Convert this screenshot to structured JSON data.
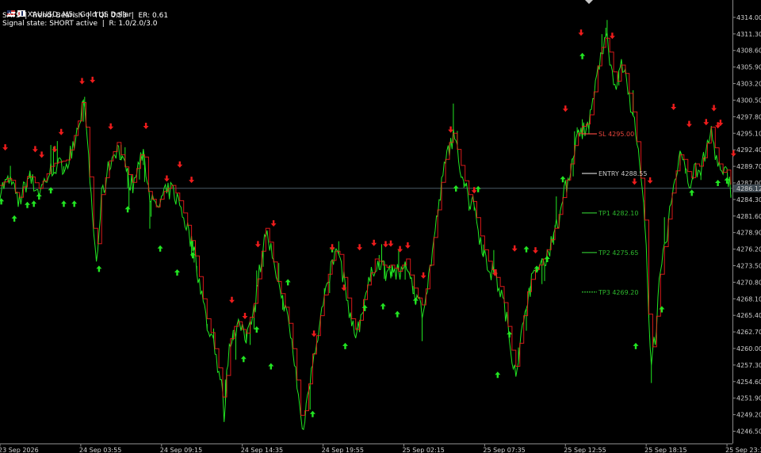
{
  "window": {
    "symbol_title": "XAUUSD, M5:  Gold US Dollar",
    "status_line": "SATS  |  Trend: Bearish  |  TQI: 0.53  |  ER: 0.61",
    "signal_line": "Signal state: SHORT active  |  R: 1.0/2.0/3.0"
  },
  "colors": {
    "background": "#000000",
    "bull": "#22e622",
    "bear": "#ee1c1c",
    "axis_text": "#d0d0d0",
    "sl": "#e8453c",
    "entry": "#c8c8c8",
    "tp": "#2db82d",
    "current_line": "#4a5a66"
  },
  "icons": {
    "up_arrow": "arrow-up-icon",
    "down_arrow": "arrow-down-icon",
    "flag": "flag-icon",
    "candles": "candles-icon"
  },
  "chart_data": {
    "type": "line",
    "title": "XAUUSD, M5:  Gold US Dollar",
    "ylim": [
      4244.5,
      4315.8
    ],
    "y_ticks": [
      "4314.00",
      "4311.30",
      "4308.60",
      "4305.90",
      "4303.20",
      "4300.50",
      "4297.80",
      "4295.10",
      "4292.40",
      "4289.70",
      "4287.00",
      "4284.30",
      "4281.60",
      "4278.90",
      "4276.20",
      "4273.50",
      "4270.80",
      "4268.10",
      "4265.40",
      "4262.70",
      "4260.00",
      "4257.30",
      "4254.60",
      "4251.90",
      "4249.20",
      "4246.50"
    ],
    "y_tick_values": [
      4314.0,
      4311.3,
      4308.6,
      4305.9,
      4303.2,
      4300.5,
      4297.8,
      4295.1,
      4292.4,
      4289.7,
      4287.0,
      4284.3,
      4281.6,
      4278.9,
      4276.2,
      4273.5,
      4270.8,
      4268.1,
      4265.4,
      4262.7,
      4260.0,
      4257.3,
      4254.6,
      4251.9,
      4249.2,
      4246.5
    ],
    "x_ticks": [
      "23 Sep 2026",
      "24 Sep 03:55",
      "24 Sep 09:15",
      "24 Sep 14:35",
      "24 Sep 19:55",
      "25 Sep 02:15",
      "25 Sep 07:35",
      "25 Sep 12:55",
      "25 Sep 18:15",
      "25 Sep 23:35"
    ],
    "x_tick_index": [
      0,
      62,
      124,
      186,
      248,
      310,
      372,
      434,
      496,
      558
    ],
    "bar_count": 562,
    "current_price": "4286.12",
    "current_price_value": 4286.12,
    "levels": [
      {
        "label": "SL  4295.00",
        "value": 4295.0,
        "kind": "sl"
      },
      {
        "label": "ENTRY  4288.55",
        "value": 4288.55,
        "kind": "entry"
      },
      {
        "label": "TP1  4282.10",
        "value": 4282.1,
        "kind": "tp"
      },
      {
        "label": "TP2  4275.65",
        "value": 4275.65,
        "kind": "tp"
      },
      {
        "label": "TP3  4269.20",
        "value": 4269.2,
        "kind": "tp"
      }
    ],
    "price_path": [
      [
        0,
        4286.0
      ],
      [
        8,
        4287.5
      ],
      [
        14,
        4283.5
      ],
      [
        22,
        4288.0
      ],
      [
        30,
        4285.5
      ],
      [
        40,
        4289.5
      ],
      [
        52,
        4290.2
      ],
      [
        60,
        4296.5
      ],
      [
        64,
        4300.5
      ],
      [
        67,
        4293.0
      ],
      [
        72,
        4279.0
      ],
      [
        74,
        4273.8
      ],
      [
        78,
        4284.5
      ],
      [
        84,
        4290.0
      ],
      [
        90,
        4293.0
      ],
      [
        96,
        4289.0
      ],
      [
        102,
        4286.5
      ],
      [
        110,
        4292.5
      ],
      [
        114,
        4285.0
      ],
      [
        120,
        4282.5
      ],
      [
        126,
        4285.0
      ],
      [
        132,
        4286.0
      ],
      [
        138,
        4283.5
      ],
      [
        144,
        4279.5
      ],
      [
        150,
        4274.5
      ],
      [
        154,
        4270.0
      ],
      [
        158,
        4265.0
      ],
      [
        162,
        4262.0
      ],
      [
        166,
        4258.5
      ],
      [
        170,
        4254.0
      ],
      [
        172,
        4249.0
      ],
      [
        175,
        4258.0
      ],
      [
        178,
        4262.5
      ],
      [
        184,
        4264.0
      ],
      [
        188,
        4261.0
      ],
      [
        192,
        4264.5
      ],
      [
        196,
        4267.5
      ],
      [
        200,
        4274.0
      ],
      [
        204,
        4279.0
      ],
      [
        208,
        4276.0
      ],
      [
        212,
        4271.0
      ],
      [
        218,
        4267.0
      ],
      [
        222,
        4263.5
      ],
      [
        226,
        4258.0
      ],
      [
        230,
        4250.5
      ],
      [
        232,
        4246.5
      ],
      [
        236,
        4252.0
      ],
      [
        240,
        4258.5
      ],
      [
        244,
        4262.5
      ],
      [
        248,
        4267.0
      ],
      [
        252,
        4271.5
      ],
      [
        256,
        4274.5
      ],
      [
        260,
        4276.0
      ],
      [
        264,
        4271.0
      ],
      [
        268,
        4266.5
      ],
      [
        272,
        4262.0
      ],
      [
        276,
        4264.0
      ],
      [
        280,
        4268.5
      ],
      [
        284,
        4271.0
      ],
      [
        288,
        4274.0
      ],
      [
        292,
        4273.5
      ],
      [
        296,
        4272.5
      ],
      [
        300,
        4273.0
      ],
      [
        306,
        4272.0
      ],
      [
        312,
        4274.0
      ],
      [
        316,
        4270.5
      ],
      [
        320,
        4268.0
      ],
      [
        324,
        4266.5
      ],
      [
        328,
        4270.0
      ],
      [
        332,
        4276.0
      ],
      [
        336,
        4282.0
      ],
      [
        340,
        4288.0
      ],
      [
        344,
        4292.5
      ],
      [
        348,
        4294.5
      ],
      [
        352,
        4291.0
      ],
      [
        356,
        4287.5
      ],
      [
        360,
        4284.5
      ],
      [
        364,
        4283.0
      ],
      [
        368,
        4278.5
      ],
      [
        372,
        4275.5
      ],
      [
        376,
        4273.0
      ],
      [
        380,
        4271.5
      ],
      [
        384,
        4269.5
      ],
      [
        388,
        4266.0
      ],
      [
        392,
        4260.0
      ],
      [
        396,
        4256.5
      ],
      [
        400,
        4261.5
      ],
      [
        404,
        4268.0
      ],
      [
        410,
        4272.0
      ],
      [
        416,
        4273.5
      ],
      [
        422,
        4276.5
      ],
      [
        426,
        4279.0
      ],
      [
        430,
        4282.0
      ],
      [
        434,
        4286.0
      ],
      [
        438,
        4289.5
      ],
      [
        442,
        4293.5
      ],
      [
        446,
        4295.5
      ],
      [
        450,
        4296.0
      ],
      [
        454,
        4298.0
      ],
      [
        458,
        4304.5
      ],
      [
        462,
        4308.5
      ],
      [
        466,
        4310.5
      ],
      [
        470,
        4305.0
      ],
      [
        474,
        4303.0
      ],
      [
        478,
        4306.5
      ],
      [
        482,
        4302.0
      ],
      [
        486,
        4298.0
      ],
      [
        490,
        4291.5
      ],
      [
        493,
        4285.0
      ],
      [
        496,
        4278.0
      ],
      [
        498,
        4265.0
      ],
      [
        500,
        4258.5
      ],
      [
        503,
        4262.0
      ],
      [
        506,
        4270.0
      ],
      [
        510,
        4276.0
      ],
      [
        514,
        4282.0
      ],
      [
        518,
        4287.5
      ],
      [
        522,
        4291.0
      ],
      [
        526,
        4290.0
      ],
      [
        530,
        4286.5
      ],
      [
        534,
        4289.5
      ],
      [
        538,
        4289.0
      ],
      [
        542,
        4292.0
      ],
      [
        546,
        4295.5
      ],
      [
        550,
        4291.0
      ],
      [
        554,
        4288.0
      ],
      [
        558,
        4288.5
      ],
      [
        561,
        4286.12
      ]
    ],
    "up_arrows": [
      {
        "i": 1,
        "v": 4284.0
      },
      {
        "i": 11,
        "v": 4281.2
      },
      {
        "i": 21,
        "v": 4283.4
      },
      {
        "i": 26,
        "v": 4283.6
      },
      {
        "i": 30,
        "v": 4284.8
      },
      {
        "i": 39,
        "v": 4285.8
      },
      {
        "i": 49,
        "v": 4283.6
      },
      {
        "i": 57,
        "v": 4283.6
      },
      {
        "i": 76,
        "v": 4273.0
      },
      {
        "i": 98,
        "v": 4282.7
      },
      {
        "i": 123,
        "v": 4276.3
      },
      {
        "i": 136,
        "v": 4272.4
      },
      {
        "i": 148,
        "v": 4275.2
      },
      {
        "i": 187,
        "v": 4258.3
      },
      {
        "i": 197,
        "v": 4263.1
      },
      {
        "i": 208,
        "v": 4257.1
      },
      {
        "i": 221,
        "v": 4270.8
      },
      {
        "i": 240,
        "v": 4249.3
      },
      {
        "i": 255,
        "v": 4276.2
      },
      {
        "i": 265,
        "v": 4260.4
      },
      {
        "i": 280,
        "v": 4266.6
      },
      {
        "i": 294,
        "v": 4266.9
      },
      {
        "i": 305,
        "v": 4265.6
      },
      {
        "i": 319,
        "v": 4267.8
      },
      {
        "i": 350,
        "v": 4286.1
      },
      {
        "i": 367,
        "v": 4286.0
      },
      {
        "i": 382,
        "v": 4255.7
      },
      {
        "i": 391,
        "v": 4262.3
      },
      {
        "i": 404,
        "v": 4276.2
      },
      {
        "i": 412,
        "v": 4273.0
      },
      {
        "i": 420,
        "v": 4274.6
      },
      {
        "i": 432,
        "v": 4287.6
      },
      {
        "i": 447,
        "v": 4307.7
      },
      {
        "i": 488,
        "v": 4260.4
      },
      {
        "i": 508,
        "v": 4266.4
      },
      {
        "i": 531,
        "v": 4285.4
      },
      {
        "i": 551,
        "v": 4287.0
      },
      {
        "i": 558,
        "v": 4287.4
      }
    ],
    "down_arrows": [
      {
        "i": 4,
        "v": 4292.8
      },
      {
        "i": 27,
        "v": 4292.5
      },
      {
        "i": 32,
        "v": 4291.6
      },
      {
        "i": 42,
        "v": 4292.5
      },
      {
        "i": 47,
        "v": 4295.3
      },
      {
        "i": 63,
        "v": 4303.6
      },
      {
        "i": 71,
        "v": 4303.8
      },
      {
        "i": 85,
        "v": 4296.2
      },
      {
        "i": 112,
        "v": 4296.3
      },
      {
        "i": 138,
        "v": 4290.0
      },
      {
        "i": 128,
        "v": 4287.7
      },
      {
        "i": 147,
        "v": 4287.5
      },
      {
        "i": 178,
        "v": 4267.9
      },
      {
        "i": 188,
        "v": 4265.3
      },
      {
        "i": 198,
        "v": 4277.0
      },
      {
        "i": 210,
        "v": 4280.4
      },
      {
        "i": 241,
        "v": 4262.4
      },
      {
        "i": 255,
        "v": 4276.5
      },
      {
        "i": 264,
        "v": 4269.9
      },
      {
        "i": 276,
        "v": 4276.5
      },
      {
        "i": 287,
        "v": 4277.2
      },
      {
        "i": 296,
        "v": 4277.0
      },
      {
        "i": 300,
        "v": 4277.1
      },
      {
        "i": 307,
        "v": 4276.2
      },
      {
        "i": 313,
        "v": 4276.8
      },
      {
        "i": 325,
        "v": 4271.9
      },
      {
        "i": 346,
        "v": 4295.7
      },
      {
        "i": 364,
        "v": 4285.8
      },
      {
        "i": 380,
        "v": 4272.3
      },
      {
        "i": 395,
        "v": 4276.3
      },
      {
        "i": 411,
        "v": 4276.0
      },
      {
        "i": 434,
        "v": 4299.1
      },
      {
        "i": 446,
        "v": 4311.5
      },
      {
        "i": 470,
        "v": 4311.0
      },
      {
        "i": 487,
        "v": 4287.2
      },
      {
        "i": 499,
        "v": 4287.4
      },
      {
        "i": 517,
        "v": 4299.4
      },
      {
        "i": 529,
        "v": 4296.6
      },
      {
        "i": 542,
        "v": 4296.9
      },
      {
        "i": 548,
        "v": 4299.2
      },
      {
        "i": 551,
        "v": 4296.4
      },
      {
        "i": 553,
        "v": 4296.8
      },
      {
        "i": 563,
        "v": 4291.8
      }
    ]
  }
}
